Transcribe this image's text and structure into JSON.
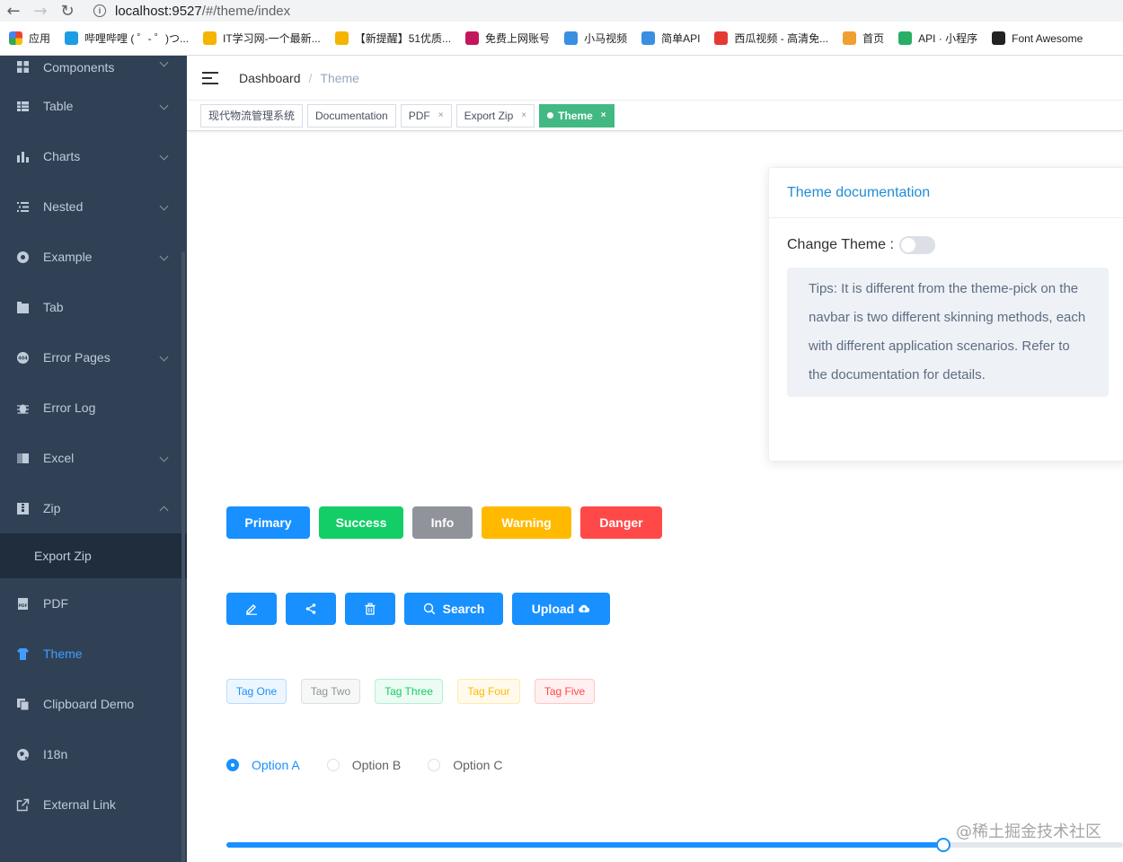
{
  "browser": {
    "url_host": "localhost:9527",
    "url_path": "/#/theme/index",
    "bookmarks": [
      {
        "label": "应用",
        "color": "#e94235"
      },
      {
        "label": "哔哩哔哩 ( ゜- ゜)つ...",
        "color": "#1e9be5"
      },
      {
        "label": "IT学习网-一个最新...",
        "color": "#f5b400"
      },
      {
        "label": "【新提醒】51优质...",
        "color": "#f5b400"
      },
      {
        "label": "免费上网账号",
        "color": "#c2185b"
      },
      {
        "label": "小马视频",
        "color": "#3b8fe0"
      },
      {
        "label": "简单API",
        "color": "#3b8fe0"
      },
      {
        "label": "西瓜视频 - 高清免...",
        "color": "#e53935"
      },
      {
        "label": "首页",
        "color": "#f0a030"
      },
      {
        "label": "API · 小程序",
        "color": "#2aae67"
      },
      {
        "label": "Font Awesome",
        "color": "#222222"
      }
    ]
  },
  "sidebar": {
    "items": [
      {
        "label": "Components",
        "icon": "components-icon",
        "arrow": "down"
      },
      {
        "label": "Table",
        "icon": "table-icon",
        "arrow": "down"
      },
      {
        "label": "Charts",
        "icon": "chart-icon",
        "arrow": "down"
      },
      {
        "label": "Nested",
        "icon": "nested-icon",
        "arrow": "down"
      },
      {
        "label": "Example",
        "icon": "example-icon",
        "arrow": "down"
      },
      {
        "label": "Tab",
        "icon": "tab-icon",
        "arrow": ""
      },
      {
        "label": "Error Pages",
        "icon": "error-404-icon",
        "arrow": "down"
      },
      {
        "label": "Error Log",
        "icon": "bug-icon",
        "arrow": ""
      },
      {
        "label": "Excel",
        "icon": "excel-icon",
        "arrow": "down"
      },
      {
        "label": "Zip",
        "icon": "zip-icon",
        "arrow": "up"
      },
      {
        "label": "Export Zip",
        "icon": "",
        "arrow": "",
        "sub": true
      },
      {
        "label": "PDF",
        "icon": "pdf-icon",
        "arrow": ""
      },
      {
        "label": "Theme",
        "icon": "theme-icon",
        "arrow": "",
        "active": true
      },
      {
        "label": "Clipboard Demo",
        "icon": "clipboard-icon",
        "arrow": ""
      },
      {
        "label": "I18n",
        "icon": "globe-icon",
        "arrow": ""
      },
      {
        "label": "External Link",
        "icon": "external-link-icon",
        "arrow": ""
      }
    ]
  },
  "navbar": {
    "breadcrumb_home": "Dashboard",
    "breadcrumb_sep": "/",
    "breadcrumb_current": "Theme"
  },
  "tagsview": [
    {
      "label": "现代物流管理系统",
      "closable": false
    },
    {
      "label": "Documentation",
      "closable": false
    },
    {
      "label": "PDF",
      "closable": true
    },
    {
      "label": "Export Zip",
      "closable": true
    },
    {
      "label": "Theme",
      "closable": true,
      "active": true
    }
  ],
  "card": {
    "title": "Theme documentation",
    "change_theme_label": "Change Theme :",
    "switch_on": false,
    "tips": "Tips: It is different from the theme-pick on the navbar is two different skinning methods, each with different application scenarios. Refer to the documentation for details."
  },
  "buttons": {
    "primary": "Primary",
    "success": "Success",
    "info": "Info",
    "warning": "Warning",
    "danger": "Danger"
  },
  "icon_buttons": {
    "search": "Search",
    "upload": "Upload"
  },
  "tags": [
    {
      "label": "Tag One",
      "type": "primary",
      "color": "#1890ff"
    },
    {
      "label": "Tag Two",
      "type": "info",
      "color": "#909399"
    },
    {
      "label": "Tag Three",
      "type": "success",
      "color": "#13ce66"
    },
    {
      "label": "Tag Four",
      "type": "warning",
      "color": "#ffba00"
    },
    {
      "label": "Tag Five",
      "type": "danger",
      "color": "#ff4949"
    }
  ],
  "radios": [
    {
      "label": "Option A",
      "checked": true
    },
    {
      "label": "Option B",
      "checked": false
    },
    {
      "label": "Option C",
      "checked": false
    }
  ],
  "slider": {
    "value_fraction": 0.8
  },
  "watermark": "@稀土掘金技术社区",
  "colors": {
    "primary": "#1890ff",
    "sidebar_bg": "#304156",
    "sidebar_active": "#409eff",
    "tagsview_active": "#42b983"
  }
}
